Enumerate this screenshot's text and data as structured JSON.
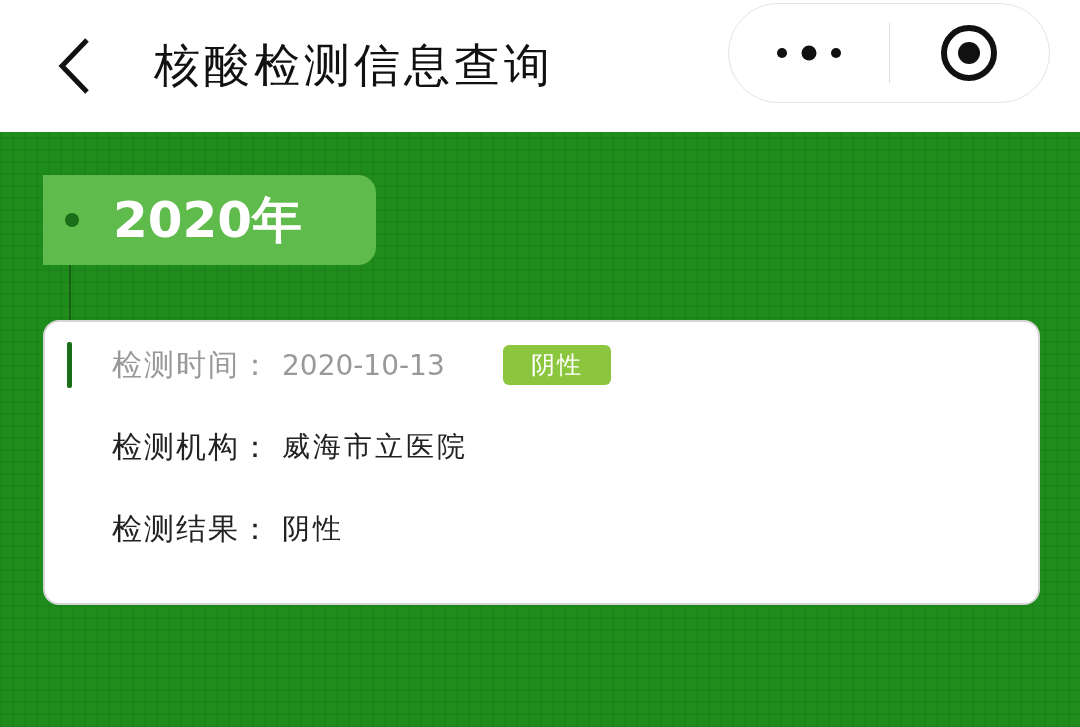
{
  "header": {
    "title": "核酸检测信息查询"
  },
  "timeline": [
    {
      "year": "2020年",
      "records": [
        {
          "badge": "阴性",
          "fields": [
            {
              "label": "检测时间：",
              "value": "2020-10-13",
              "kind": "muted"
            },
            {
              "label": "检测机构：",
              "value": "威海市立医院",
              "kind": "normal"
            },
            {
              "label": "检测结果：",
              "value": "阴性",
              "kind": "normal"
            }
          ]
        }
      ]
    }
  ]
}
